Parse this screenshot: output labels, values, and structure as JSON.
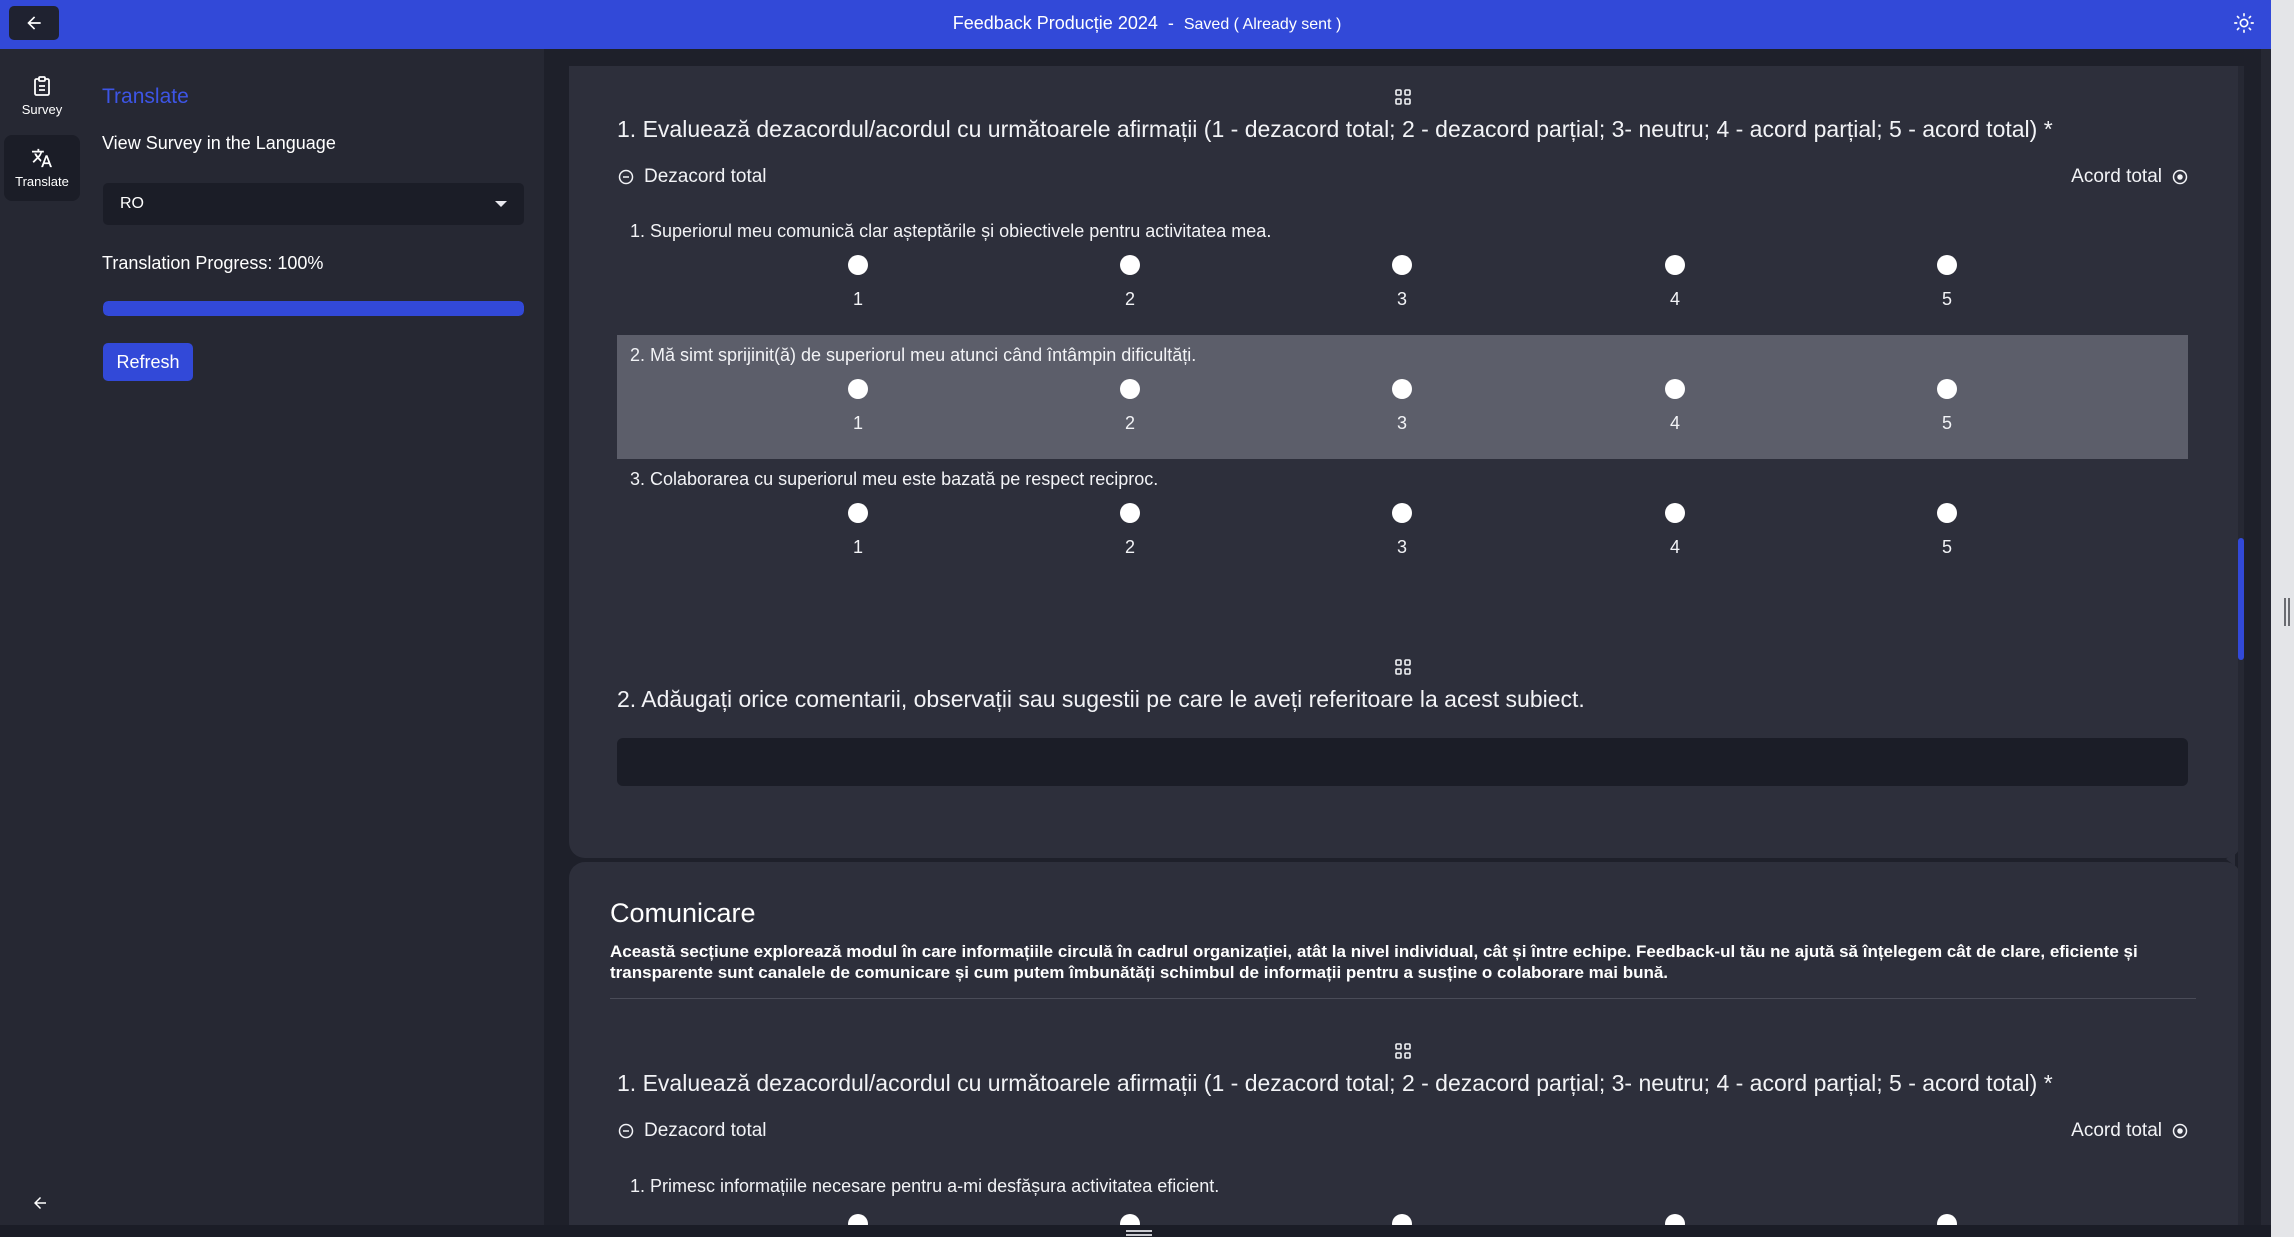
{
  "header": {
    "title": "Feedback Producție 2024",
    "separator": "-",
    "status": "Saved ( Already sent )"
  },
  "rail": {
    "items": [
      {
        "label": "Survey",
        "icon": "clipboard-icon",
        "active": false
      },
      {
        "label": "Translate",
        "icon": "translate-icon",
        "active": true
      }
    ]
  },
  "panel": {
    "title": "Translate",
    "subtitle": "View Survey in the Language",
    "selected_language": "RO",
    "progress_label": "Translation Progress: 100%",
    "progress_percent": 100,
    "refresh_label": "Refresh"
  },
  "questions": [
    {
      "title": "1. Evaluează dezacordul/acordul cu următoarele afirmații (1 - dezacord total; 2 - dezacord parțial; 3- neutru; 4 - acord parțial; 5 - acord total) *",
      "scale_min": "Dezacord total",
      "scale_max": "Acord total",
      "statements": [
        "1. Superiorul meu comunică clar așteptările și obiectivele pentru activitatea mea.",
        "2. Mă simt sprijinit(ă) de superiorul meu atunci când întâmpin dificultăți.",
        "3. Colaborarea cu superiorul meu este bazată pe respect reciproc."
      ],
      "options": [
        "1",
        "2",
        "3",
        "4",
        "5"
      ]
    },
    {
      "title": "2. Adăugați orice comentarii, observații sau sugestii pe care le aveți referitoare la acest subiect.",
      "comment_value": ""
    }
  ],
  "section": {
    "title": "Comunicare",
    "description": "Această secțiune explorează modul în care informațiile circulă în cadrul organizației, atât la nivel individual, cât și între echipe. Feedback-ul tău ne ajută să înțelegem cât de clare, eficiente și transparente sunt canalele de comunicare și cum putem îmbunătăți schimbul de informații pentru a susține o colaborare mai bună.",
    "question": {
      "title": "1. Evaluează dezacordul/acordul cu următoarele afirmații (1 - dezacord total; 2 - dezacord parțial; 3- neutru; 4 - acord parțial; 5 - acord total) *",
      "scale_min": "Dezacord total",
      "scale_max": "Acord total",
      "statement": "1. Primesc informațiile necesare pentru a-mi desfășura activitatea eficient."
    }
  },
  "colors": {
    "accent": "#3249d8",
    "panel_title": "#3d55e6",
    "background": "#262833",
    "card": "#2d2f3b",
    "highlight_row": "#5c5e6a"
  }
}
